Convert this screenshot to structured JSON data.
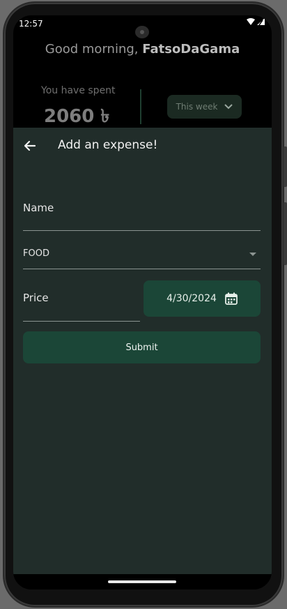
{
  "status_bar": {
    "time": "12:57",
    "icons": [
      "wifi-icon",
      "signal-icon"
    ]
  },
  "header": {
    "greeting_prefix": "Good morning, ",
    "username": "FatsoDaGama",
    "spent_label": "You have spent",
    "spent_amount": "2060 ৳",
    "period_selector": {
      "value": "This week",
      "icon": "chevron-down-icon"
    }
  },
  "sheet": {
    "title": "Add an expense!",
    "back_icon": "arrow-left-icon",
    "name_field": {
      "label": "Name",
      "value": ""
    },
    "category_select": {
      "value": "FOOD",
      "icon": "caret-down-icon"
    },
    "price_field": {
      "label": "Price",
      "value": ""
    },
    "date_button": {
      "value": "4/30/2024",
      "icon": "calendar-icon"
    },
    "submit_label": "Submit"
  },
  "colors": {
    "sheet_bg": "#212d2a",
    "accent_button": "#1b4637",
    "divider": "#1f3e30"
  }
}
